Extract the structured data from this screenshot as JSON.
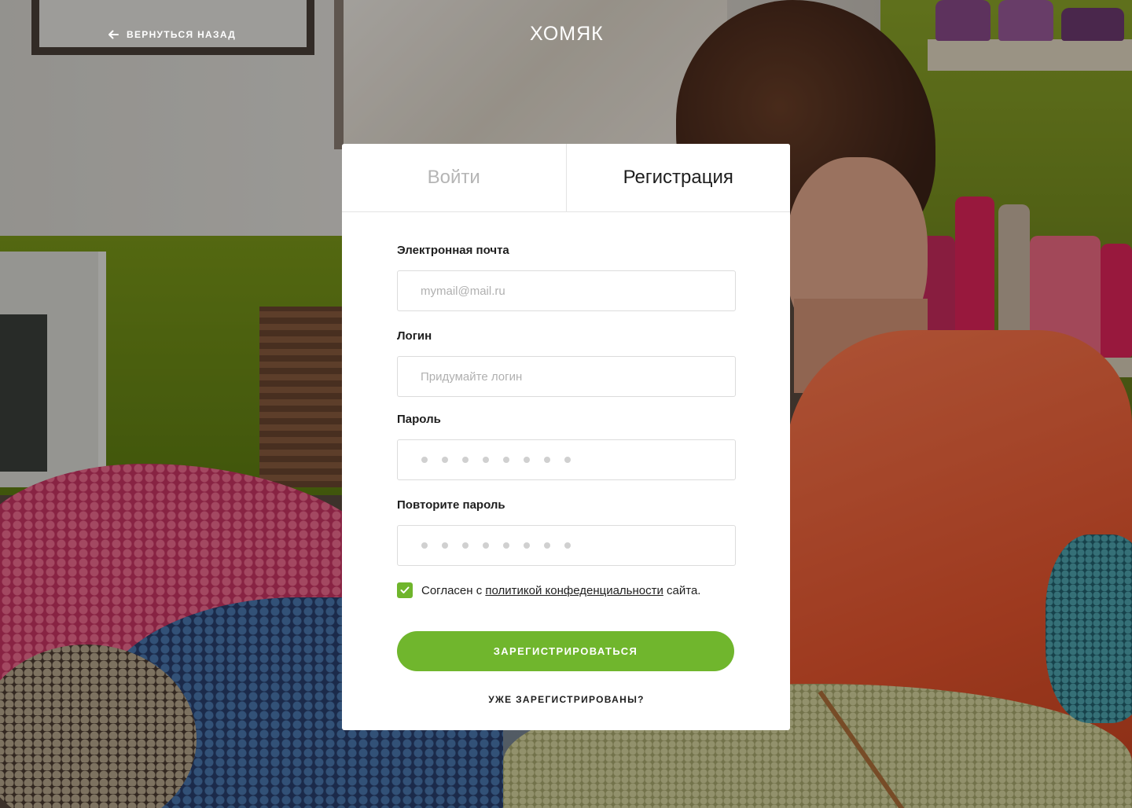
{
  "header": {
    "back_label": "ВЕРНУТЬСЯ НАЗАД",
    "logo_text": "ХОМЯК"
  },
  "tabs": [
    {
      "label": "Войти",
      "active": false
    },
    {
      "label": "Регистрация",
      "active": true
    }
  ],
  "form": {
    "email": {
      "label": "Электронная почта",
      "placeholder": "mymail@mail.ru",
      "value": ""
    },
    "login": {
      "label": "Логин",
      "placeholder": "Придумайте логин",
      "value": ""
    },
    "password": {
      "label": "Пароль",
      "masked_dots": 8
    },
    "password_repeat": {
      "label": "Повторите пароль",
      "masked_dots": 8
    },
    "agree": {
      "checked": true,
      "prefix": "Согласен с ",
      "link": "политикой конфеденциальности",
      "suffix": " сайта."
    },
    "submit_label": "ЗАРЕГИСТРИРОВАТЬСЯ",
    "already_label": "УЖЕ ЗАРЕГИСТРИРОВАНЫ?"
  },
  "colors": {
    "accent": "#70b62d",
    "text": "#1e1e1e",
    "inactive_tab": "#b5b5b5",
    "placeholder": "#b0b0b0"
  },
  "icons": {
    "back": "arrow-left-icon",
    "checkbox": "checkmark-icon"
  }
}
